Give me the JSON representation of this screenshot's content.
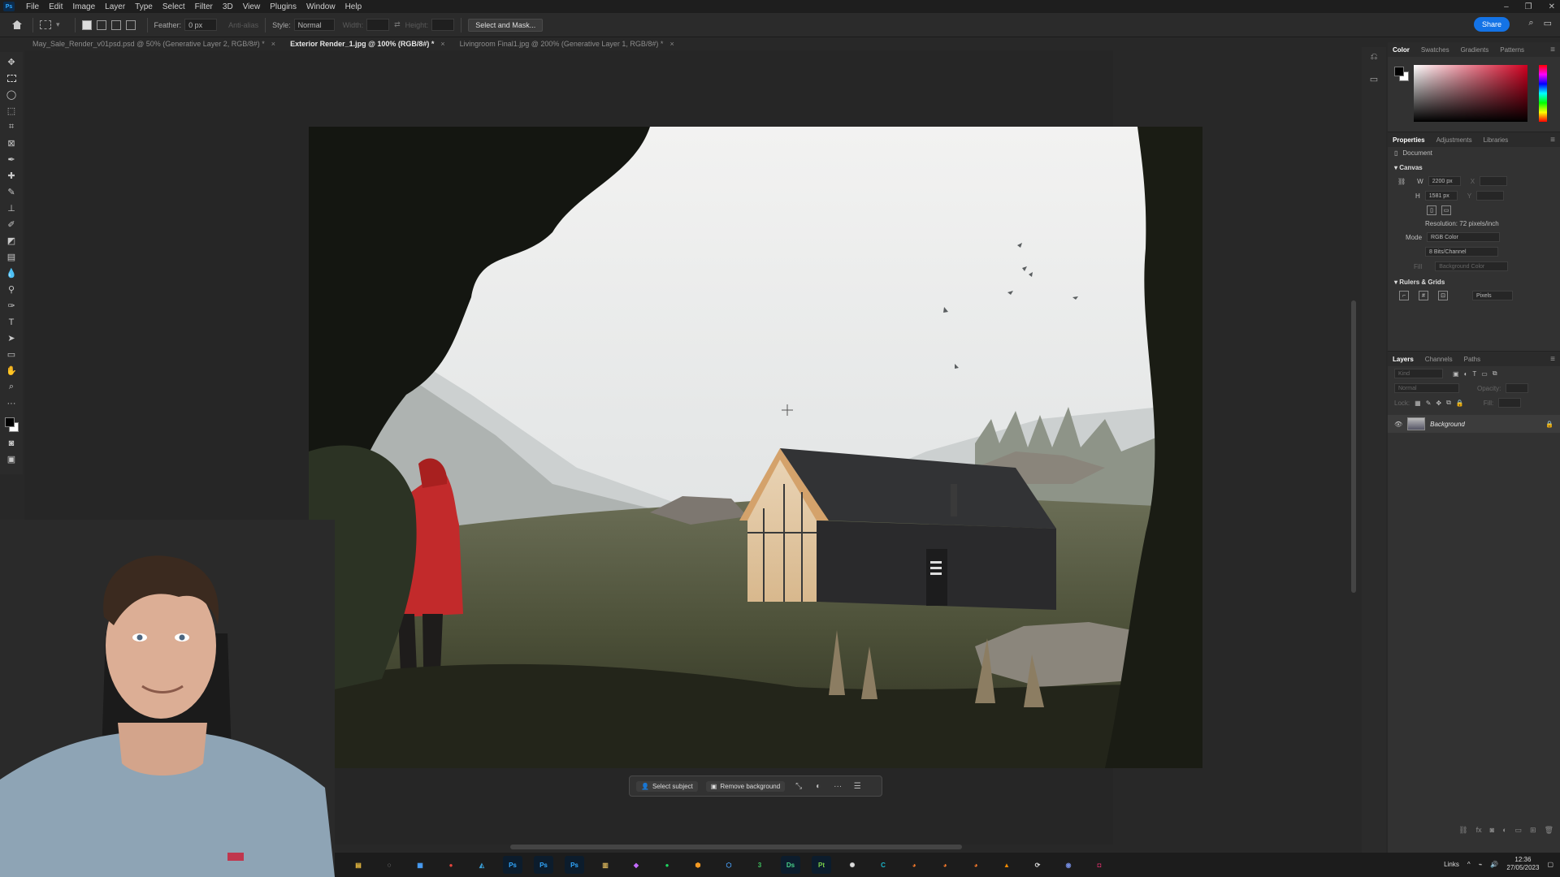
{
  "menubar": {
    "logo": "Ps",
    "items": [
      "File",
      "Edit",
      "Image",
      "Layer",
      "Type",
      "Select",
      "Filter",
      "3D",
      "View",
      "Plugins",
      "Window",
      "Help"
    ],
    "window_controls": [
      "–",
      "❐",
      "✕"
    ]
  },
  "options": {
    "feather_label": "Feather:",
    "feather_value": "0 px",
    "antialias_label": "Anti-alias",
    "style_label": "Style:",
    "style_value": "Normal",
    "width_label": "Width:",
    "height_label": "Height:",
    "select_mask_button": "Select and Mask...",
    "share_button": "Share"
  },
  "tabs": [
    {
      "label": "May_Sale_Render_v01psd.psd @ 50% (Generative Layer 2, RGB/8#) *",
      "close": "×"
    },
    {
      "label": "Exterior Render_1.jpg @ 100% (RGB/8#) *",
      "close": "×"
    },
    {
      "label": "Livingroom Final1.jpg @ 200% (Generative Layer 1, RGB/8#) *",
      "close": "×"
    }
  ],
  "contextual_bar": {
    "select_subject": "Select subject",
    "remove_background": "Remove background"
  },
  "color_panel": {
    "tabs": [
      "Color",
      "Swatches",
      "Gradients",
      "Patterns"
    ],
    "foreground": "#000000",
    "background": "#ffffff"
  },
  "properties": {
    "tabs": [
      "Properties",
      "Adjustments",
      "Libraries"
    ],
    "document_label": "Document",
    "canvas_title": "Canvas",
    "w_label": "W",
    "w_value": "2200 px",
    "h_label": "H",
    "h_value": "1581 px",
    "x_label": "X",
    "y_label": "Y",
    "resolution": "Resolution: 72 pixels/inch",
    "mode_label": "Mode",
    "mode_value": "RGB Color",
    "bits_value": "8 Bits/Channel",
    "fill_label": "Fill",
    "fill_value": "Background Color",
    "rulers_title": "Rulers & Grids",
    "units_value": "Pixels"
  },
  "layers": {
    "tabs": [
      "Layers",
      "Channels",
      "Paths"
    ],
    "search_placeholder": "Kind",
    "blend_mode": "Normal",
    "opacity_label": "Opacity:",
    "lock_label": "Lock:",
    "fill_label": "Fill:",
    "layer_name": "Background"
  },
  "windows_taskbar": {
    "apps": [
      {
        "name": "file-explorer-icon",
        "glyph": "▤",
        "color": "#f0c040"
      },
      {
        "name": "settings-icon",
        "glyph": "◌",
        "color": "#cccccc"
      },
      {
        "name": "calculator-icon",
        "glyph": "▦",
        "color": "#4aa3ff"
      },
      {
        "name": "chrome-icon",
        "glyph": "●",
        "color": "#e8453c"
      },
      {
        "name": "app-icon-1",
        "glyph": "◭",
        "color": "#3a9fd6"
      },
      {
        "name": "photoshop-icon-1",
        "glyph": "Ps",
        "color": "#31a8ff"
      },
      {
        "name": "photoshop-icon-2",
        "glyph": "Ps",
        "color": "#31a8ff"
      },
      {
        "name": "photoshop-icon-3",
        "glyph": "Ps",
        "color": "#31a8ff"
      },
      {
        "name": "notes-icon",
        "glyph": "▥",
        "color": "#d8b35a"
      },
      {
        "name": "affinity-icon",
        "glyph": "◆",
        "color": "#c46bff"
      },
      {
        "name": "spotify-icon",
        "glyph": "●",
        "color": "#1ed760"
      },
      {
        "name": "box-icon",
        "glyph": "⬢",
        "color": "#f59a23"
      },
      {
        "name": "sketchup-icon",
        "glyph": "⬡",
        "color": "#4aa3ff"
      },
      {
        "name": "app-icon-3",
        "glyph": "3",
        "color": "#3fbf5f"
      },
      {
        "name": "dimension-icon",
        "glyph": "Ds",
        "color": "#48d18a"
      },
      {
        "name": "painter-icon",
        "glyph": "Pt",
        "color": "#7bd14b"
      },
      {
        "name": "app-icon-2",
        "glyph": "✺",
        "color": "#dddddd"
      },
      {
        "name": "app-icon-c",
        "glyph": "C",
        "color": "#19b5c9"
      },
      {
        "name": "blender-icon-1",
        "glyph": "◕",
        "color": "#f5792a"
      },
      {
        "name": "blender-icon-2",
        "glyph": "◕",
        "color": "#f5792a"
      },
      {
        "name": "blender-icon-3",
        "glyph": "◕",
        "color": "#f5792a"
      },
      {
        "name": "vlc-icon",
        "glyph": "▲",
        "color": "#f08a00"
      },
      {
        "name": "sync-icon",
        "glyph": "⟳",
        "color": "#dddddd"
      },
      {
        "name": "discord-icon",
        "glyph": "◉",
        "color": "#7289da"
      },
      {
        "name": "instagram-icon",
        "glyph": "◘",
        "color": "#e1306c"
      }
    ],
    "tray_links": "Links",
    "time": "12:36",
    "date": "27/05/2023"
  }
}
